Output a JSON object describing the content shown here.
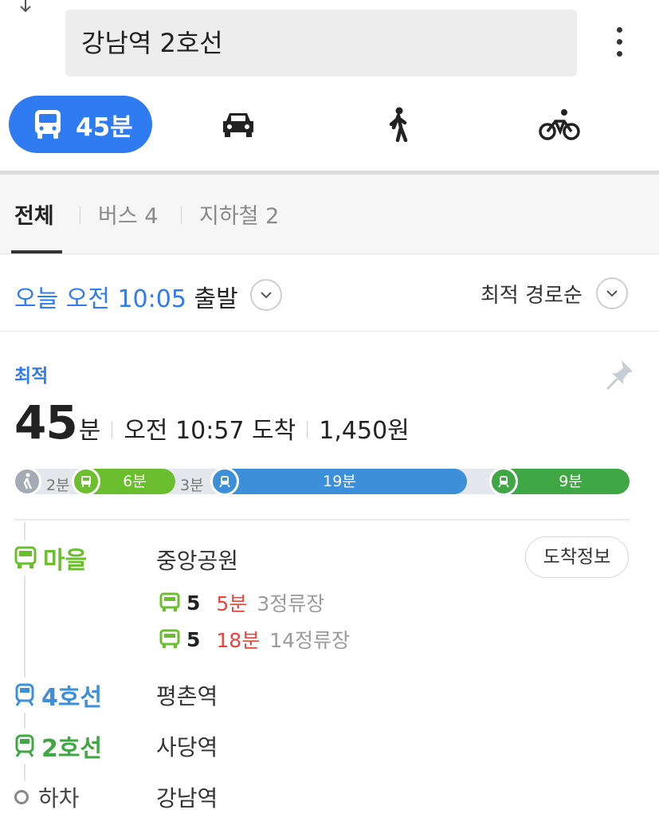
{
  "search": {
    "query": "강남역 2호선"
  },
  "modes": {
    "transit_time": "45분"
  },
  "tabs": [
    {
      "label": "전체"
    },
    {
      "label": "버스 4"
    },
    {
      "label": "지하철 2"
    }
  ],
  "departure": {
    "time_text": "오늘 오전 10:05",
    "suffix": " 출발",
    "sort_label": "최적 경로순"
  },
  "route": {
    "badge": "최적",
    "duration_num": "45",
    "duration_unit": "분",
    "arrival": "오전 10:57 도착",
    "fare": "1,450원",
    "timeline": {
      "walk": "2분",
      "bus": "6분",
      "transfer_walk": "3분",
      "subway4": "19분",
      "subway2": "9분"
    },
    "steps": [
      {
        "type": "마을",
        "stop": "중앙공원"
      },
      {
        "type": "4호선",
        "stop": "평촌역"
      },
      {
        "type": "2호선",
        "stop": "사당역"
      }
    ],
    "arrival_info_label": "도착정보",
    "buses": [
      {
        "number": "5",
        "eta": "5분",
        "stops": "3정류장"
      },
      {
        "number": "5",
        "eta": "18분",
        "stops": "14정류장"
      }
    ],
    "getoff": {
      "label": "하차",
      "stop": "강남역"
    }
  },
  "colors": {
    "accent": "#2f7bf2",
    "village_bus": "#6bbf2e",
    "line4": "#3d8fd9",
    "line2": "#3fa845",
    "eta_red": "#e8473e"
  }
}
